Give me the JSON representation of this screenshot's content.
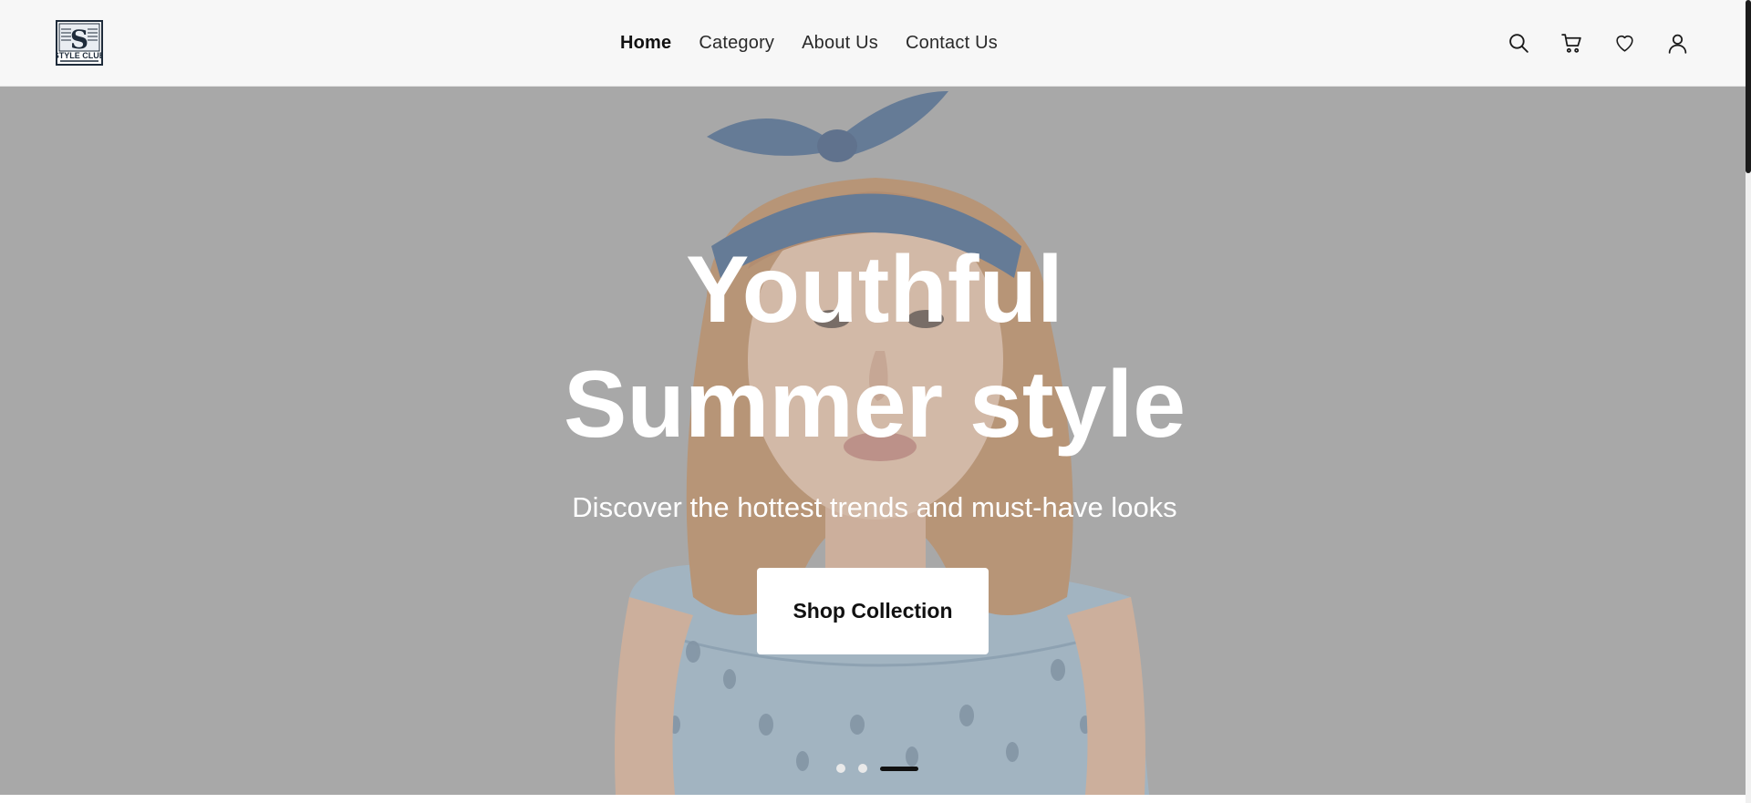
{
  "header": {
    "logo": {
      "letter": "S",
      "wordmark": "STYLE CLUB"
    },
    "nav": [
      {
        "label": "Home",
        "active": true
      },
      {
        "label": "Category",
        "active": false
      },
      {
        "label": "About Us",
        "active": false
      },
      {
        "label": "Contact Us",
        "active": false
      }
    ],
    "icons": [
      "search-icon",
      "cart-icon",
      "heart-icon",
      "user-icon"
    ]
  },
  "hero": {
    "title_line1": "Youthful",
    "title_line2": "Summer style",
    "subtitle": "Discover the hottest trends and must-have looks",
    "cta_label": "Shop Collection",
    "slides": {
      "count": 3,
      "active_index": 2
    }
  },
  "colors": {
    "header_bg": "#f7f7f7",
    "hero_overlay": "#a8a8a8",
    "headband": "#3c5f8f",
    "dress": "#9fbfd6",
    "hair": "#c88a55",
    "text_light": "#ffffff",
    "text_dark": "#111111"
  }
}
